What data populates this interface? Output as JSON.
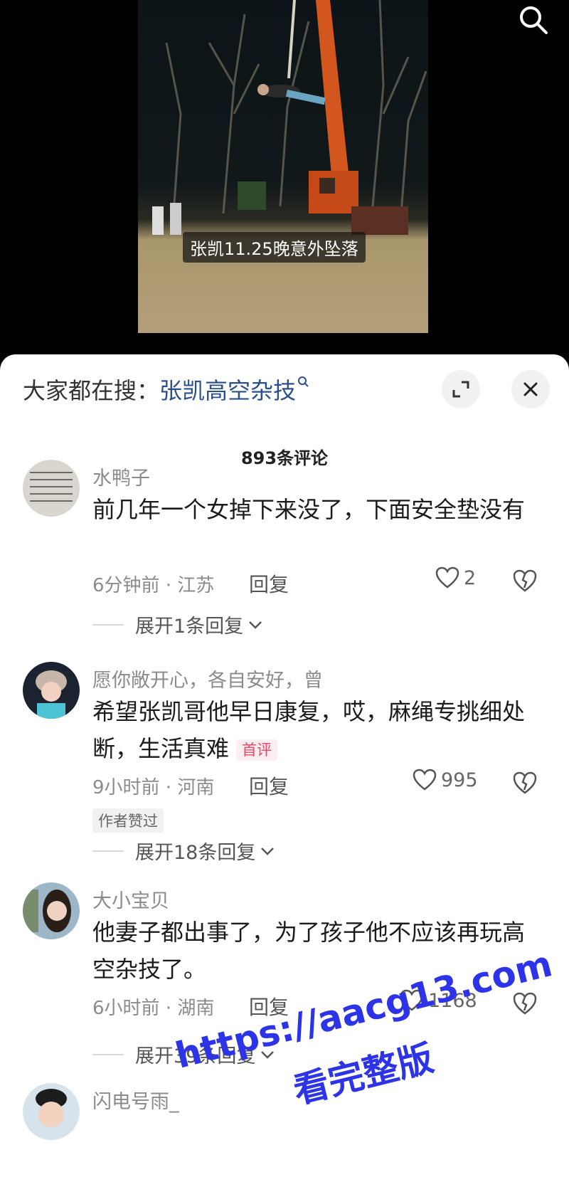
{
  "video": {
    "caption": "张凯11.25晚意外坠落"
  },
  "hot_search": {
    "prefix": "大家都在搜：",
    "keyword": "张凯高空杂技"
  },
  "comment_count": "893条评论",
  "comments": [
    {
      "name": "水鸭子",
      "text": "前几年一个女掉下来没了，下面安全垫没有",
      "time_location": "6分钟前 · 江苏",
      "reply": "回复",
      "likes": "2",
      "expand": "展开1条回复"
    },
    {
      "name": "愿你敞开心，各自安好，曾",
      "text": "希望张凯哥他早日康复，哎，麻绳专挑细处断，生活真难",
      "badge": "首评",
      "time_location": "9小时前 · 河南",
      "reply": "回复",
      "likes": "995",
      "author_liked": "作者赞过",
      "expand": "展开18条回复"
    },
    {
      "name": "大小宝贝",
      "text": "他妻子都出事了，为了孩子他不应该再玩高空杂技了。",
      "time_location": "6小时前 · 湖南",
      "reply": "回复",
      "likes": "1168",
      "expand": "展开39条回复"
    },
    {
      "name": "闪电号雨_"
    }
  ],
  "watermark": {
    "line1": "https://aacg13.com",
    "line2": "看完整版"
  },
  "colors": {
    "keyword": "#2a4f8a",
    "badge": "#e8496a",
    "watermark": "#2d34e8"
  }
}
